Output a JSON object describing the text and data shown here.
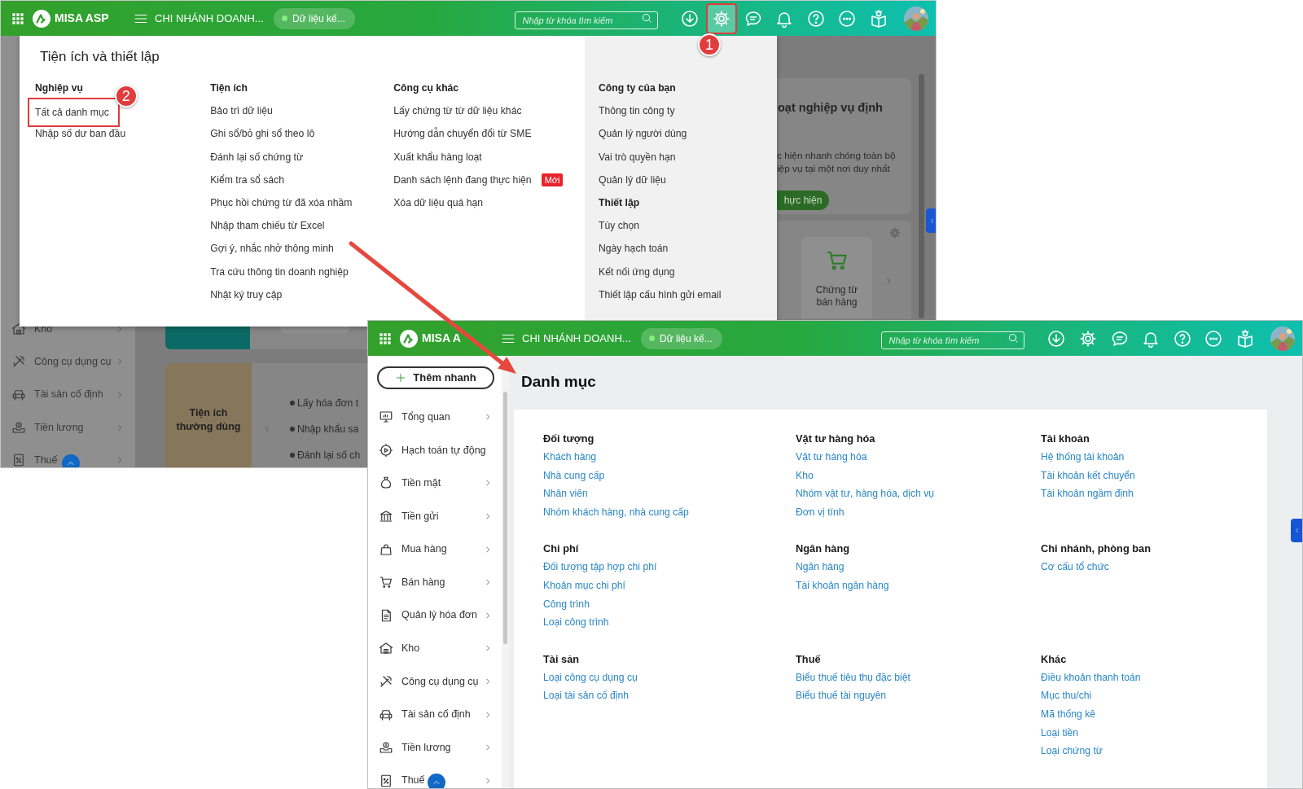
{
  "settings_screen": {
    "header": {
      "logo": "MISA ASP",
      "branch": "CHI NHÁNH DOANH...",
      "status": "Dữ liệu kế...",
      "search_placeholder": "Nhập từ khóa tìm kiếm",
      "icons": [
        {
          "kind": "download",
          "active": false,
          "outlined": false
        },
        {
          "kind": "settings",
          "active": true,
          "outlined": true,
          "callout": "1"
        },
        {
          "kind": "chat",
          "active": false,
          "outlined": false
        },
        {
          "kind": "bell",
          "active": false,
          "outlined": false
        },
        {
          "kind": "help",
          "active": false,
          "outlined": false
        },
        {
          "kind": "more",
          "active": false,
          "outlined": false
        },
        {
          "kind": "guide",
          "active": false,
          "outlined": false
        }
      ]
    },
    "settings_menu": {
      "title": "Tiện ích và thiết lập",
      "columns": [
        {
          "sections": [
            {
              "heading": "Nghiệp vụ",
              "items": [
                {
                  "label": "Tất cả danh mục",
                  "outlined": true,
                  "callout": "2"
                },
                {
                  "label": "Nhập số dư ban đầu",
                  "outlined": false
                }
              ]
            }
          ]
        },
        {
          "sections": [
            {
              "heading": "Tiện ích",
              "items": [
                {
                  "label": "Bảo trì dữ liệu",
                  "outlined": false
                },
                {
                  "label": "Ghi sổ/bỏ ghi sổ theo lô",
                  "outlined": false
                },
                {
                  "label": "Đánh lại số chứng từ",
                  "outlined": false
                },
                {
                  "label": "Kiểm tra sổ sách",
                  "outlined": false
                },
                {
                  "label": "Phục hồi chứng từ đã xóa nhầm",
                  "outlined": false
                },
                {
                  "label": "Nhập tham chiếu từ Excel",
                  "outlined": false
                },
                {
                  "label": "Gợi ý, nhắc nhở thông minh",
                  "outlined": false
                },
                {
                  "label": "Tra cứu thông tin doanh nghiệp",
                  "outlined": false
                },
                {
                  "label": "Nhật ký truy cập",
                  "outlined": false
                }
              ]
            }
          ]
        },
        {
          "sections": [
            {
              "heading": "Công cụ khác",
              "items": [
                {
                  "label": "Lấy chứng từ từ dữ liệu khác",
                  "outlined": false
                },
                {
                  "label": "Hướng dẫn chuyển đổi từ SME",
                  "outlined": false
                },
                {
                  "label": "Xuất khẩu hàng loạt",
                  "outlined": false
                },
                {
                  "label": "Danh sách lệnh đang thực hiện",
                  "badge": "Mới",
                  "outlined": false
                },
                {
                  "label": "Xóa dữ liệu quá hạn",
                  "outlined": false
                }
              ]
            }
          ]
        },
        {
          "kind": "shaded",
          "sections": [
            {
              "heading": "Công ty của bạn",
              "items": [
                {
                  "label": "Thông tin công ty",
                  "outlined": false
                },
                {
                  "label": "Quản lý người dùng",
                  "outlined": false
                },
                {
                  "label": "Vai trò quyền hạn",
                  "outlined": false
                },
                {
                  "label": "Quản lý dữ liệu",
                  "outlined": false
                }
              ]
            },
            {
              "heading": "Thiết lập",
              "items": [
                {
                  "label": "Tùy chọn",
                  "outlined": false
                },
                {
                  "label": "Ngày hạch toán",
                  "outlined": false
                },
                {
                  "label": "Kết nối ứng dụng",
                  "outlined": false
                },
                {
                  "label": "Thiết lập cấu hình gửi email",
                  "outlined": false
                }
              ]
            }
          ]
        }
      ]
    },
    "background": {
      "sidebar_items": [
        {
          "label": "Kho",
          "submenu": true
        },
        {
          "label": "Công cụ dụng cụ",
          "submenu": true
        },
        {
          "label": "Tài sản cố định",
          "submenu": true
        },
        {
          "label": "Tiền lương",
          "submenu": true
        },
        {
          "label": "Thuế",
          "submenu": true
        }
      ],
      "feature_title": "oạt nghiệp vụ định",
      "feature_lines": [
        "c hiện nhanh chóng toàn bộ",
        "iệp vụ tại một nơi duy nhất"
      ],
      "feature_button": "hực hiện",
      "shortcut_tile": "Chứng từ bán hàng",
      "utilities_card": "Tiện ích thường dùng",
      "utility_items": [
        "Lấy hóa đơn t",
        "Nhập khẩu sa",
        "Đánh lại số ch"
      ]
    }
  },
  "catalog_screen": {
    "header": {
      "logo": "MISA A",
      "branch": "CHI NHÁNH DOANH...",
      "status": "Dữ liệu kế...",
      "search_placeholder": "Nhập từ khóa tìm kiếm",
      "icons": [
        {
          "kind": "download",
          "active": false,
          "outlined": false
        },
        {
          "kind": "settings",
          "active": false,
          "outlined": false
        },
        {
          "kind": "chat",
          "active": false,
          "outlined": false
        },
        {
          "kind": "bell",
          "active": false,
          "outlined": false
        },
        {
          "kind": "help",
          "active": false,
          "outlined": false
        },
        {
          "kind": "more",
          "active": false,
          "outlined": false
        },
        {
          "kind": "guide",
          "active": false,
          "outlined": false
        }
      ]
    },
    "quick_add": "Thêm nhanh",
    "sidebar_items": [
      {
        "label": "Tổng quan",
        "submenu": true
      },
      {
        "label": "Hạch toán tự động",
        "submenu": false
      },
      {
        "label": "Tiền mặt",
        "submenu": true
      },
      {
        "label": "Tiền gửi",
        "submenu": true
      },
      {
        "label": "Mua hàng",
        "submenu": true
      },
      {
        "label": "Bán hàng",
        "submenu": true
      },
      {
        "label": "Quản lý hóa đơn",
        "submenu": true
      },
      {
        "label": "Kho",
        "submenu": true
      },
      {
        "label": "Công cụ dụng cụ",
        "submenu": true
      },
      {
        "label": "Tài sản cố định",
        "submenu": true
      },
      {
        "label": "Tiền lương",
        "submenu": true
      },
      {
        "label": "Thuế",
        "submenu": true
      }
    ],
    "page_title": "Danh mục",
    "category_groups": [
      {
        "heading": "Đối tượng",
        "links": [
          "Khách hàng",
          "Nhà cung cấp",
          "Nhân viên",
          "Nhóm khách hàng, nhà cung cấp"
        ]
      },
      {
        "heading": "Vật tư hàng hóa",
        "links": [
          "Vật tư hàng hóa",
          "Kho",
          "Nhóm vật tư, hàng hóa, dịch vụ",
          "Đơn vị tính"
        ]
      },
      {
        "heading": "Tài khoản",
        "links": [
          "Hệ thống tài khoản",
          "Tài khoản kết chuyển",
          "Tài khoản ngầm định"
        ]
      },
      {
        "heading": "Chi phí",
        "links": [
          "Đối tượng tập hợp chi phí",
          "Khoản mục chi phí",
          "Công trình",
          "Loại công trình"
        ]
      },
      {
        "heading": "Ngân hàng",
        "links": [
          "Ngân hàng",
          "Tài khoản ngân hàng"
        ]
      },
      {
        "heading": "Chi nhánh, phòng ban",
        "links": [
          "Cơ cấu tổ chức"
        ]
      },
      {
        "heading": "Tài sản",
        "links": [
          "Loại công cụ dụng cụ",
          "Loại tài sản cố định"
        ]
      },
      {
        "heading": "Thuế",
        "links": [
          "Biểu thuế tiêu thụ đặc biệt",
          "Biểu thuế tài nguyên"
        ]
      },
      {
        "heading": "Khác",
        "links": [
          "Điều khoản thanh toán",
          "Mục thu/chi",
          "Mã thống kê",
          "Loại tiền",
          "Loại chứng từ"
        ]
      }
    ]
  }
}
